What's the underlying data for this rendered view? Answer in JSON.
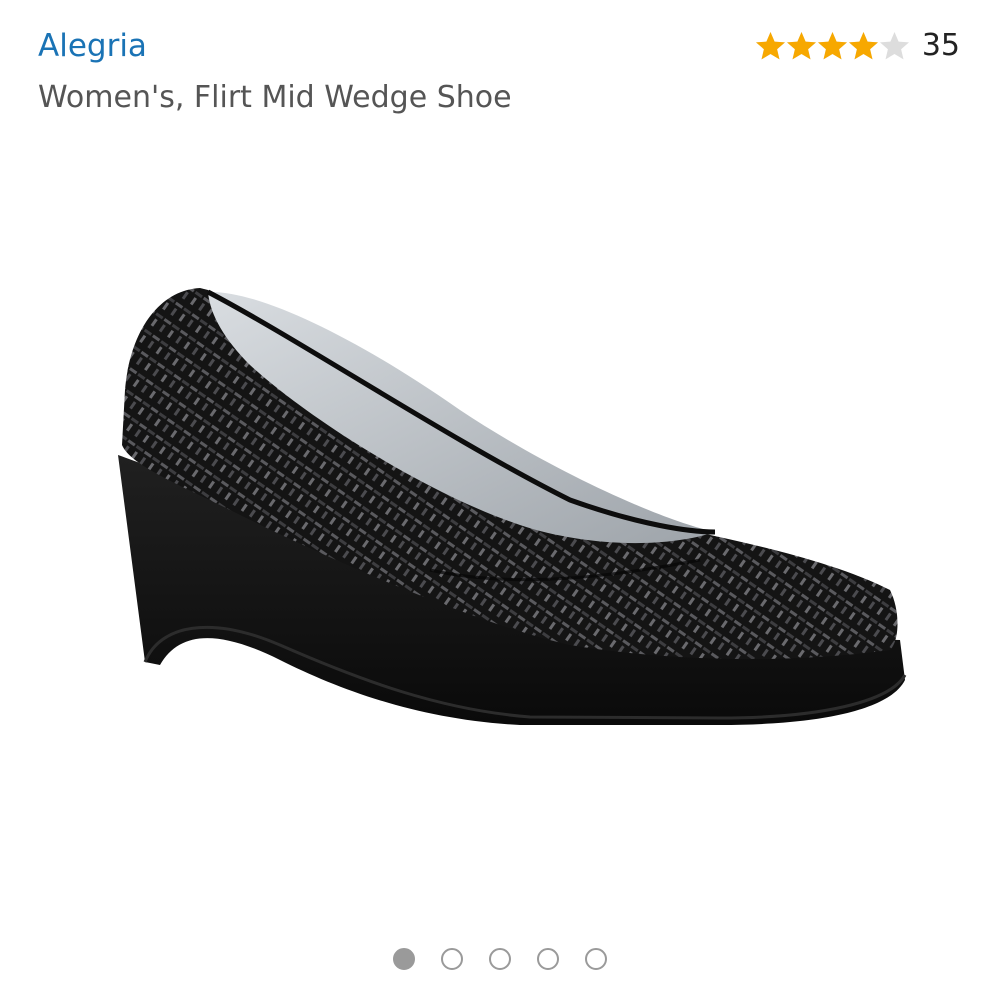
{
  "product": {
    "brand": "Alegria",
    "title": "Women's, Flirt Mid Wedge Shoe"
  },
  "rating": {
    "stars": 4.0,
    "max_stars": 5,
    "count": "35",
    "star_color": "#f7a800",
    "empty_star_color": "#dddddd"
  },
  "image": {
    "icon": "black-wedge-shoe-image"
  },
  "carousel": {
    "total": 5,
    "active_index": 0,
    "dot_color": "#9a9a9a"
  },
  "colors": {
    "brand_link": "#1a73b5",
    "title_text": "#555555"
  }
}
